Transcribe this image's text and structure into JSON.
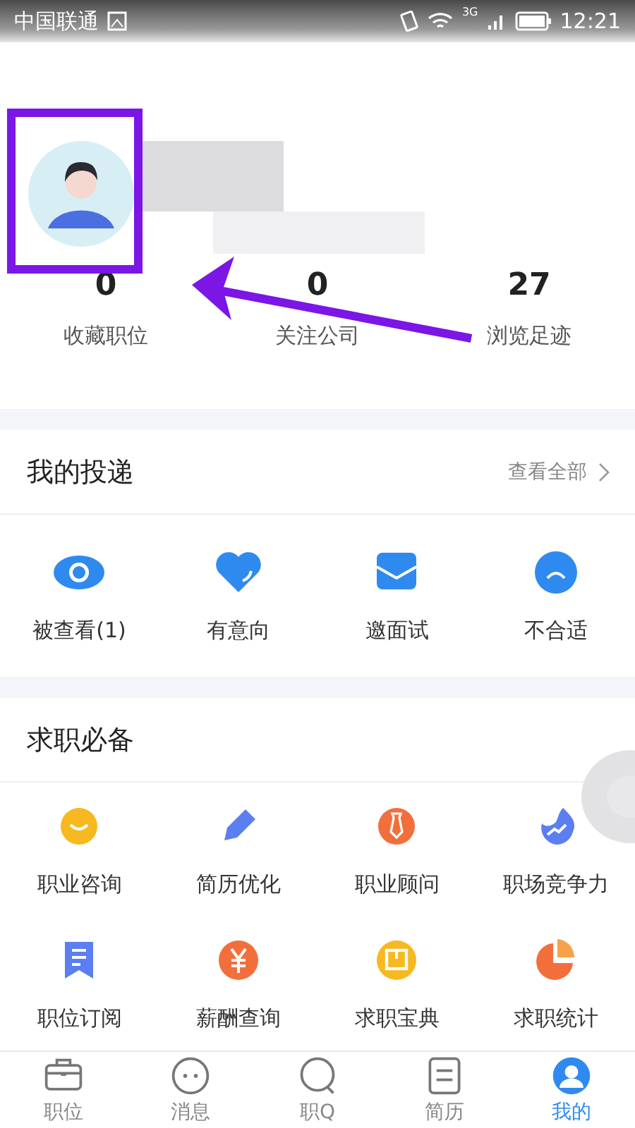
{
  "status_bar": {
    "carrier": "中国联通",
    "network": "3G",
    "time": "12:21"
  },
  "profile": {
    "stats": [
      {
        "value": "0",
        "label": "收藏职位"
      },
      {
        "value": "0",
        "label": "关注公司"
      },
      {
        "value": "27",
        "label": "浏览足迹"
      }
    ]
  },
  "delivery": {
    "title": "我的投递",
    "link": "查看全部",
    "items": [
      {
        "label": "被查看(1)"
      },
      {
        "label": "有意向"
      },
      {
        "label": "邀面试"
      },
      {
        "label": "不合适"
      }
    ]
  },
  "tools": {
    "title": "求职必备",
    "items": [
      {
        "label": "职业咨询"
      },
      {
        "label": "简历优化"
      },
      {
        "label": "职业顾问"
      },
      {
        "label": "职场竞争力"
      },
      {
        "label": "职位订阅"
      },
      {
        "label": "薪酬查询"
      },
      {
        "label": "求职宝典"
      },
      {
        "label": "求职统计"
      }
    ]
  },
  "tab_bar": [
    {
      "label": "职位",
      "selected": false
    },
    {
      "label": "消息",
      "selected": false
    },
    {
      "label": "职Q",
      "selected": false
    },
    {
      "label": "简历",
      "selected": false
    },
    {
      "label": "我的",
      "selected": true
    }
  ]
}
